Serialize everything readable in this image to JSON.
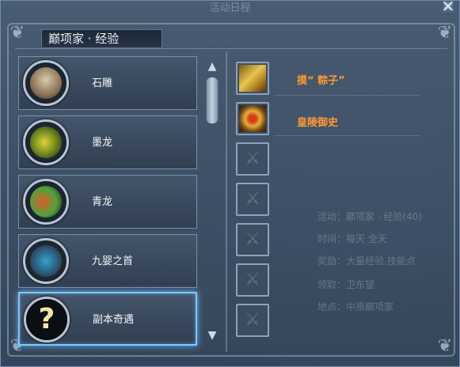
{
  "window": {
    "title": "活动日程",
    "close_icon": "close-icon"
  },
  "header": {
    "category": "巅项家 · 经验"
  },
  "list": {
    "items": [
      {
        "label": "石雕",
        "icon": "stone-statue-portrait"
      },
      {
        "label": "墨龙",
        "icon": "ink-dragon-portrait"
      },
      {
        "label": "青龙",
        "icon": "azure-dragon-portrait"
      },
      {
        "label": "九婴之首",
        "icon": "nine-headed-beast-portrait"
      },
      {
        "label": "副本奇遇",
        "icon": "question-mark-portrait",
        "selected": true
      }
    ]
  },
  "rewards": [
    {
      "name": "摸“ 粽子”",
      "icon": "gold-armor-icon"
    },
    {
      "name": "皇陵御史",
      "icon": "red-gold-helmet-icon"
    },
    {
      "name": "",
      "icon": "empty-slot-icon"
    },
    {
      "name": "",
      "icon": "empty-slot-icon"
    },
    {
      "name": "",
      "icon": "empty-slot-icon"
    },
    {
      "name": "",
      "icon": "empty-slot-icon"
    },
    {
      "name": "",
      "icon": "empty-slot-icon"
    }
  ],
  "background_info": {
    "line1": "活动：巅项家 · 经验(40)",
    "line2": "时间：每天 全天",
    "line3": "奖励：大量经验,技能点",
    "line4": "领取：卫东望",
    "line5": "地点：中原巅项家"
  },
  "colors": {
    "reward_text": "#ff9a2e",
    "selection_glow": "#7ec7ff"
  }
}
